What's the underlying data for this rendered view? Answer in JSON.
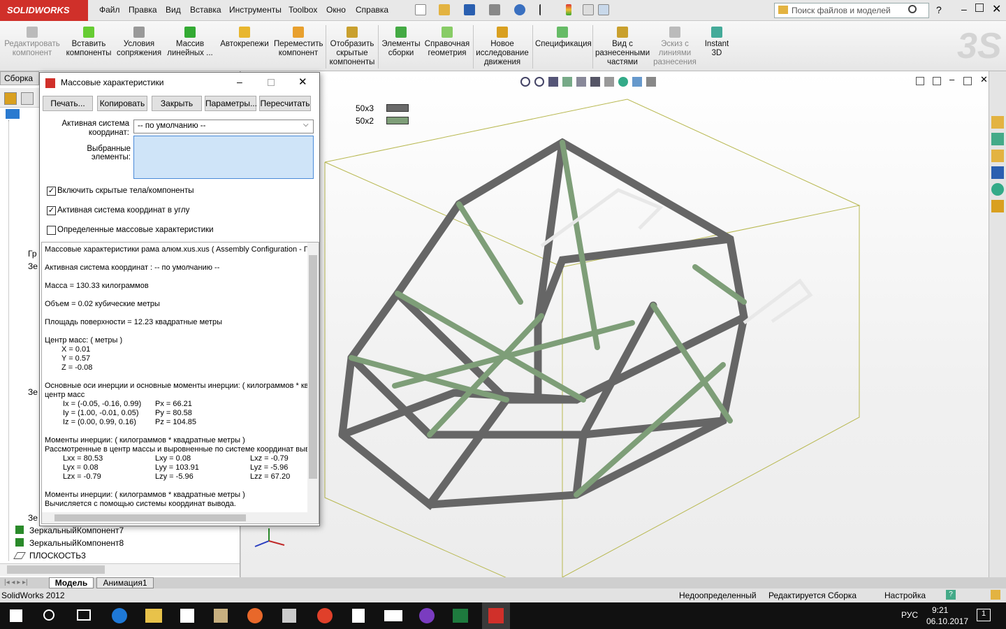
{
  "app": {
    "logo": "SOLIDWORKS",
    "title": "SolidWorks 2012"
  },
  "menu": [
    "Файл",
    "Правка",
    "Вид",
    "Вставка",
    "Инструменты",
    "Toolbox",
    "Окно",
    "Справка"
  ],
  "search": {
    "placeholder": "Поиск файлов и моделей"
  },
  "ribbon": [
    {
      "label": "Редактировать компонент",
      "disabled": true
    },
    {
      "label": "Вставить компоненты"
    },
    {
      "label": "Условия сопряжения"
    },
    {
      "label": "Массив линейных ..."
    },
    {
      "label": "Автокрепежи"
    },
    {
      "label": "Переместить компонент"
    },
    {
      "label": "Отобразить скрытые компоненты"
    },
    {
      "label": "Элементы сборки"
    },
    {
      "label": "Справочная геометрия"
    },
    {
      "label": "Новое исследование движения"
    },
    {
      "label": "Спецификация"
    },
    {
      "label": "Вид с разнесенными частями"
    },
    {
      "label": "Эскиз с линиями разнесения",
      "disabled": true
    },
    {
      "label": "Instant 3D"
    }
  ],
  "left": {
    "tab": "Сборка",
    "tree": [
      "Гр",
      "Зе",
      "Зе",
      "Зе",
      "ЗеркальныйКомпонент7",
      "ЗеркальныйКомпонент8",
      "ПЛОСКОСТЬ3"
    ]
  },
  "legend": [
    {
      "label": "50x3",
      "color": "#6a6a6a"
    },
    {
      "label": "50x2",
      "color": "#7e9e78"
    }
  ],
  "dialog": {
    "title": "Массовые характеристики",
    "buttons": [
      "Печать...",
      "Копировать",
      "Закрыть",
      "Параметры...",
      "Пересчитать"
    ],
    "coord_label": "Активная система координат:",
    "coord_value": "-- по умолчанию --",
    "selected_label": "Выбранные элементы:",
    "checkboxes": [
      {
        "label": "Включить скрытые тела/компоненты",
        "checked": "✓"
      },
      {
        "label": "Активная система координат в углу",
        "checked": "✓"
      },
      {
        "label": "Определенные массовые характеристики",
        "checked": ""
      }
    ],
    "results": [
      "Массовые характеристики рама алюм.xus.xus ( Assembly Configuration - Г",
      "Активная система координат : -- по умолчанию --",
      "Масса = 130.33 килограммов",
      "Объем = 0.02 кубические метры",
      "Площадь поверхности = 12.23 квадратные метры",
      "Центр масс: ( метры )",
      "X = 0.01",
      "Y = 0.57",
      "Z = -0.08",
      "Основные оси инерции и основные моменты инерции: ( килограммов * кв",
      "центр масс",
      "Ix = (-0.05, -0.16, 0.99)",
      "Px = 66.21",
      "Iy = (1.00, -0.01, 0.05)",
      "Py = 80.58",
      "Iz = (0.00, 0.99, 0.16)",
      "Pz = 104.85",
      "Моменты инерции: ( килограммов * квадратные метры )",
      "Рассмотренные в центр массы и выровненные по системе координат выв",
      "Lxx = 80.53",
      "Lxy = 0.08",
      "Lxz = -0.79",
      "Lyx = 0.08",
      "Lyy = 103.91",
      "Lyz = -5.96",
      "Lzx = -0.79",
      "Lzy = -5.96",
      "Lzz = 67.20",
      "Моменты инерции: ( килограммов * квадратные метры )",
      "Вычисляется с помощью системы координат вывода."
    ]
  },
  "bottom_tabs": [
    "Модель",
    "Анимация1"
  ],
  "status": {
    "app": "SolidWorks 2012",
    "state1": "Недоопределенный",
    "state2": "Редактируется Сборка",
    "settings": "Настройка"
  },
  "taskbar": {
    "lang": "РУС",
    "time": "9:21",
    "date": "06.10.2017",
    "badge": "1"
  }
}
